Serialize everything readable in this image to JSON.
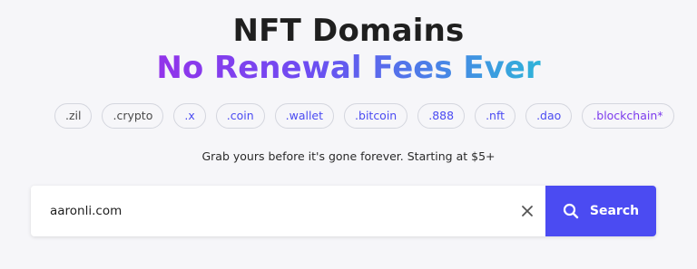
{
  "hero": {
    "title": "NFT Domains",
    "subtitle": "No Renewal Fees Ever"
  },
  "tlds": [
    {
      "label": ".zil",
      "color": "#4a4a4a"
    },
    {
      "label": ".crypto",
      "color": "#4a4a4a"
    },
    {
      "label": ".x",
      "color": "#4b4bf2"
    },
    {
      "label": ".coin",
      "color": "#4b4bf2"
    },
    {
      "label": ".wallet",
      "color": "#4b4bf2"
    },
    {
      "label": ".bitcoin",
      "color": "#4b4bf2"
    },
    {
      "label": ".888",
      "color": "#4b4bf2"
    },
    {
      "label": ".nft",
      "color": "#4b4bf2"
    },
    {
      "label": ".dao",
      "color": "#4b4bf2"
    },
    {
      "label": ".blockchain*",
      "color": "#7c3aed"
    }
  ],
  "tagline": "Grab yours before it's gone forever. Starting at $5+",
  "search": {
    "value": "aaronli.com",
    "button_label": "Search",
    "clear_icon": "close-icon",
    "search_icon": "magnifier-icon",
    "accent_color": "#4b4bf2"
  }
}
